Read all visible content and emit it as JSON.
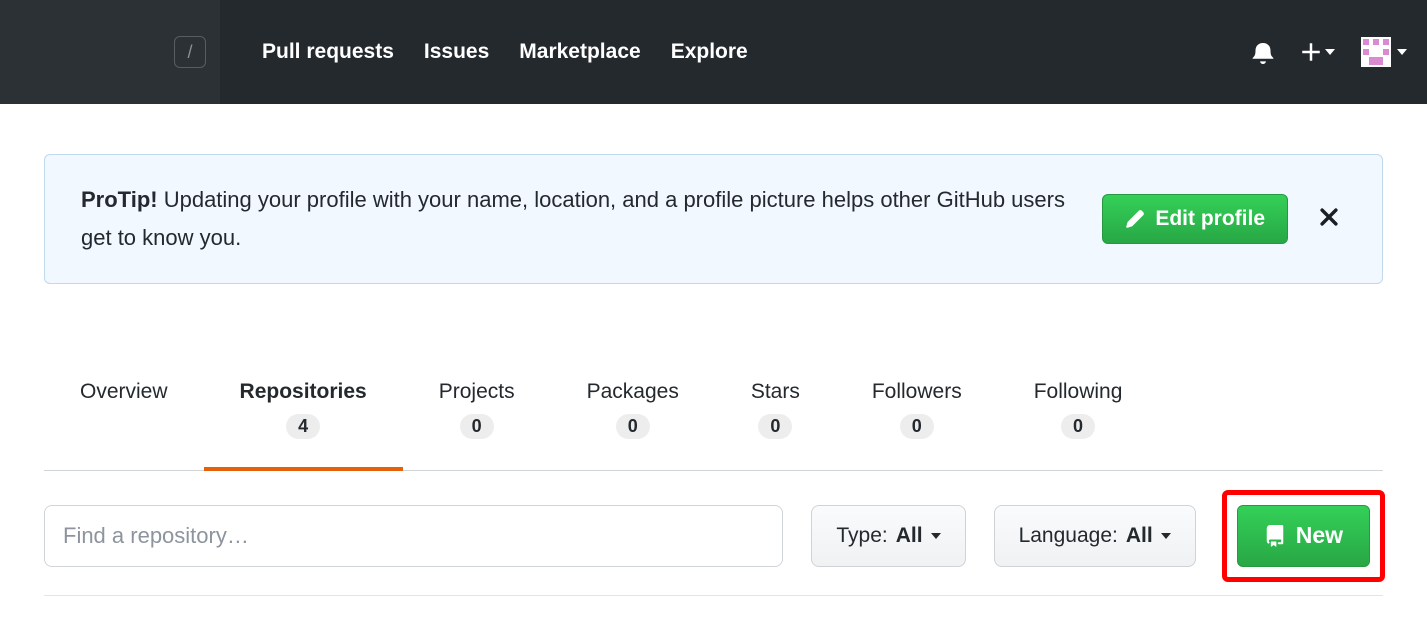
{
  "header": {
    "nav": {
      "pull_requests": "Pull requests",
      "issues": "Issues",
      "marketplace": "Marketplace",
      "explore": "Explore"
    },
    "search_shortcut": "/"
  },
  "flash": {
    "protip_label": "ProTip!",
    "message": " Updating your profile with your name, location, and a profile picture helps other GitHub users get to know you.",
    "edit_profile_label": "Edit profile"
  },
  "tabs": {
    "overview": {
      "label": "Overview"
    },
    "repositories": {
      "label": "Repositories",
      "count": "4"
    },
    "projects": {
      "label": "Projects",
      "count": "0"
    },
    "packages": {
      "label": "Packages",
      "count": "0"
    },
    "stars": {
      "label": "Stars",
      "count": "0"
    },
    "followers": {
      "label": "Followers",
      "count": "0"
    },
    "following": {
      "label": "Following",
      "count": "0"
    }
  },
  "filters": {
    "search_placeholder": "Find a repository…",
    "type_label": "Type: ",
    "type_value": "All",
    "language_label": "Language: ",
    "language_value": "All",
    "new_label": "New"
  }
}
